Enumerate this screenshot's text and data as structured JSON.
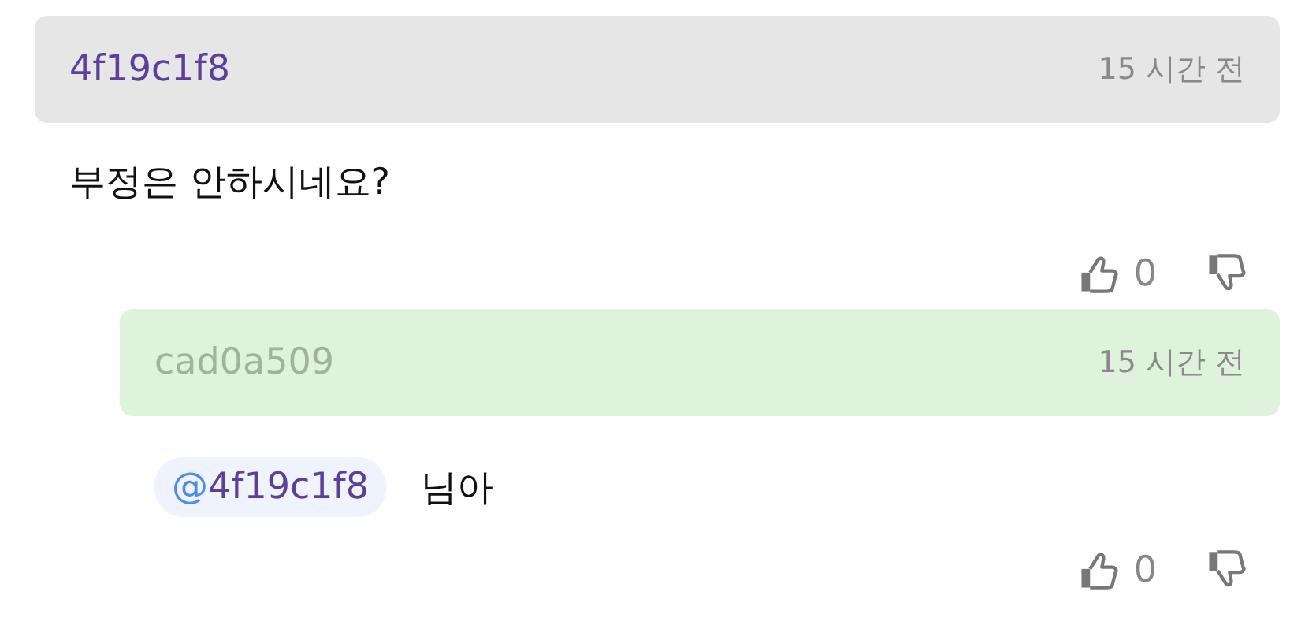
{
  "comments": [
    {
      "kind": "comment",
      "author": "4f19c1f8",
      "time": "15 시간 전",
      "body": "부정은 안하시네요?",
      "likes": "0"
    },
    {
      "kind": "reply",
      "author": "cad0a509",
      "time": "15 시간 전",
      "mention": "@4f19c1f8",
      "body": "님아",
      "likes": "0"
    }
  ]
}
